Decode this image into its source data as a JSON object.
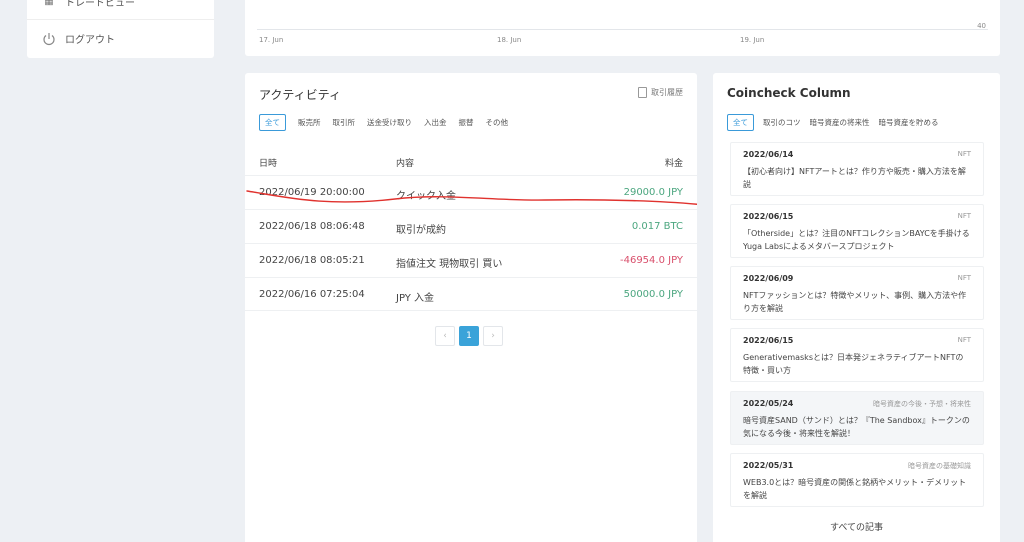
{
  "sidebar": {
    "top_item_label": "トレードビュー",
    "logout_label": "ログアウト"
  },
  "chart": {
    "x_ticks": [
      "17. Jun",
      "18. Jun",
      "19. Jun"
    ],
    "y_label": "40"
  },
  "activity": {
    "title": "アクティビティ",
    "history_link": "取引履歴",
    "tabs": [
      "全て",
      "販売所",
      "取引所",
      "送金受け取り",
      "入出金",
      "振替",
      "その他"
    ],
    "columns": [
      "日時",
      "内容",
      "料金"
    ],
    "rows": [
      {
        "date": "2022/06/19 20:00:00",
        "desc": "クイック入金",
        "fee": "29000.0 JPY"
      },
      {
        "date": "2022/06/18 08:06:48",
        "desc": "取引が成約",
        "fee": "0.017 BTC"
      },
      {
        "date": "2022/06/18 08:05:21",
        "desc": "指値注文 現物取引 買い",
        "fee": "-46954.0 JPY"
      },
      {
        "date": "2022/06/16 07:25:04",
        "desc": "JPY 入金",
        "fee": "50000.0 JPY"
      }
    ],
    "pager": {
      "prev": "‹",
      "current": "1",
      "next": "›"
    }
  },
  "column": {
    "title": "Coincheck Column",
    "tabs": [
      "全て",
      "取引のコツ",
      "暗号資産の将来性",
      "暗号資産を貯める"
    ],
    "articles": [
      {
        "date": "2022/06/14",
        "category": "NFT",
        "text": "【初心者向け】NFTアートとは？作り方や販売・購入方法を解説"
      },
      {
        "date": "2022/06/15",
        "category": "NFT",
        "text": "「Otherside」とは？注目のNFTコレクションBAYCを手掛けるYuga Labsによるメタバースプロジェクト"
      },
      {
        "date": "2022/06/09",
        "category": "NFT",
        "text": "NFTファッションとは？特徴やメリット、事例、購入方法や作り方を解説"
      },
      {
        "date": "2022/06/15",
        "category": "NFT",
        "text": "Generativemasksとは？日本発ジェネラティブアートNFTの特徴・買い方"
      },
      {
        "date": "2022/05/24",
        "category": "暗号資産の今後・予想・将来性",
        "text": "暗号資産SAND（サンド）とは？『The Sandbox』トークンの気になる今後・将来性を解説！"
      },
      {
        "date": "2022/05/31",
        "category": "暗号資産の基礎知識",
        "text": "WEB3.0とは？暗号資産の関係と銘柄やメリット・デメリットを解説"
      }
    ],
    "all_link": "すべての記事"
  },
  "colors": {
    "accent": "#3a9ad9",
    "positive": "#4ba67f",
    "negative": "#d9506c",
    "annotation": "#e0322e"
  }
}
